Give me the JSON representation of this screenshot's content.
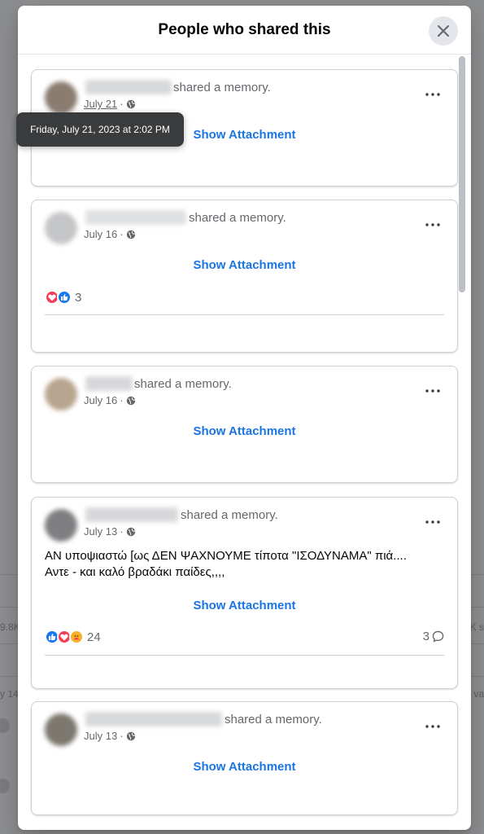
{
  "background": {
    "snippets": [
      "9.8K",
      "K s",
      "y 14",
      "va"
    ]
  },
  "modal": {
    "title": "People who shared this"
  },
  "posts": [
    {
      "action": "shared a memory.",
      "date": "July 21",
      "attachment": "Show Attachment"
    },
    {
      "action": "shared a memory.",
      "date": "July 16",
      "attachment": "Show Attachment",
      "reaction_count": "3"
    },
    {
      "action": "shared a memory.",
      "date": "July 16",
      "attachment": "Show Attachment"
    },
    {
      "action": "shared a memory.",
      "date": "July 13",
      "text_line1": "ΑΝ υποψιαστώ [ως ΔΕΝ ΨΑΧΝΟΥΜΕ τίποτα \"ΙΣΟΔΥΝΑΜΑ\" πιά....",
      "text_line2": "Αντε - και καλό βραδάκι παίδες,,,,",
      "attachment": "Show Attachment",
      "reaction_count": "24",
      "comment_count": "3"
    },
    {
      "action": "shared a memory.",
      "date": "July 13",
      "attachment": "Show Attachment"
    }
  ],
  "tooltip": {
    "text": "Friday, July 21, 2023 at 2:02 PM"
  },
  "icons": {
    "close": "close-icon",
    "more": "more-icon",
    "globe": "globe-icon",
    "love": "love-reaction-icon",
    "like": "like-reaction-icon",
    "care": "care-reaction-icon",
    "comment": "comment-icon"
  },
  "colors": {
    "link": "#1b74e4",
    "like": "#1877f2",
    "love": "#f33e58"
  }
}
